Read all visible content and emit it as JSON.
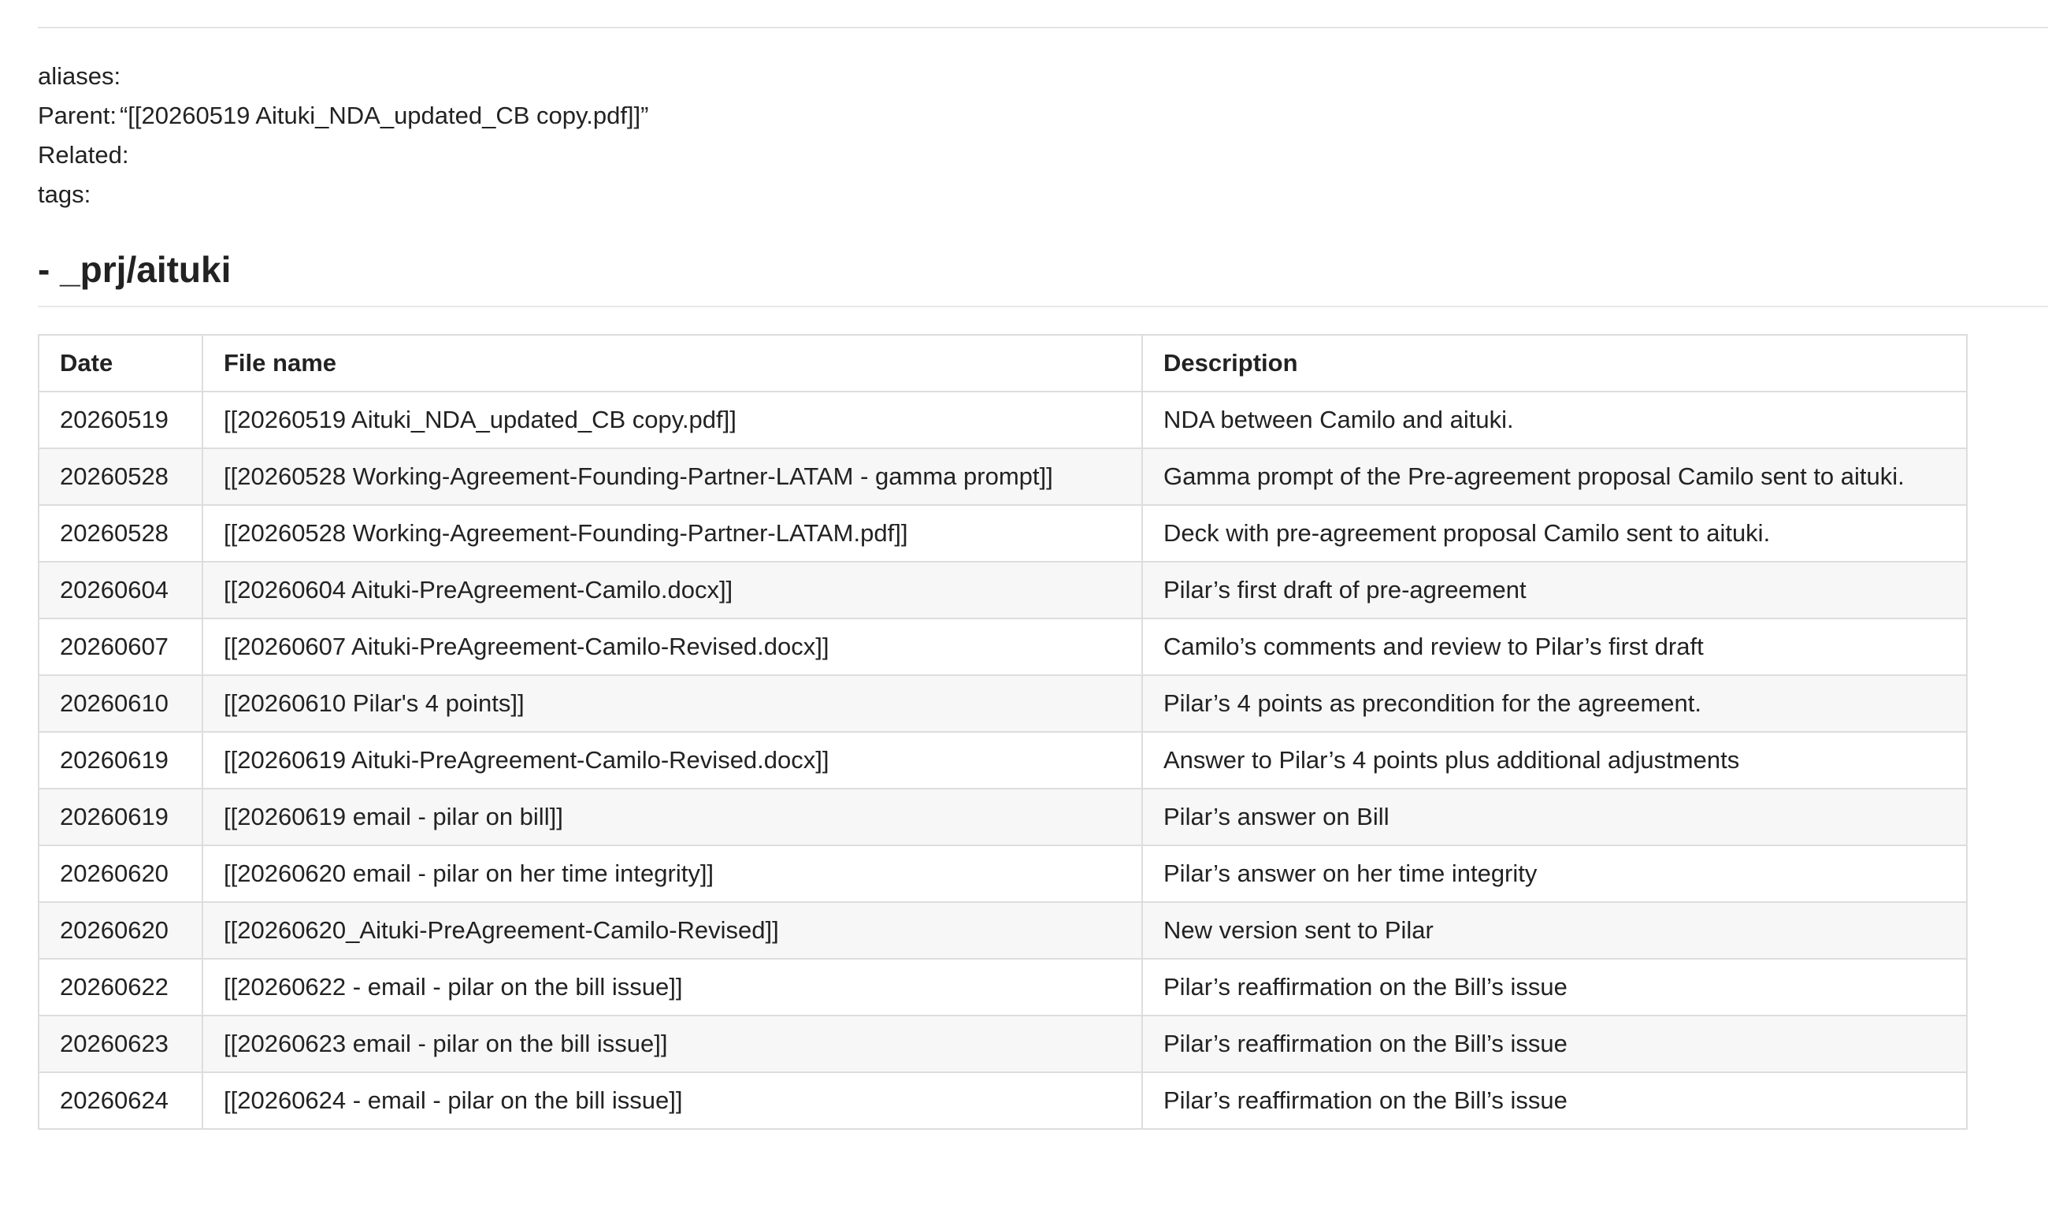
{
  "frontmatter": {
    "aliases": {
      "key": "aliases:",
      "value": ""
    },
    "parent": {
      "key": "Parent:",
      "value": "“[[20260519 Aituki_NDA_updated_CB copy.pdf]]”"
    },
    "related": {
      "key": "Related:",
      "value": ""
    },
    "tags": {
      "key": "tags:",
      "value": ""
    }
  },
  "heading": "- _prj/aituki",
  "table": {
    "headers": [
      "Date",
      "File name",
      "Description"
    ],
    "rows": [
      [
        "20260519",
        "[[20260519 Aituki_NDA_updated_CB copy.pdf]]",
        "NDA between Camilo and aituki."
      ],
      [
        "20260528",
        "[[20260528 Working-Agreement-Founding-Partner-LATAM - gamma prompt]]",
        "Gamma prompt of the Pre-agreement proposal Camilo sent to aituki."
      ],
      [
        "20260528",
        "[[20260528 Working-Agreement-Founding-Partner-LATAM.pdf]]",
        "Deck with pre-agreement proposal Camilo sent to aituki."
      ],
      [
        "20260604",
        "[[20260604 Aituki-PreAgreement-Camilo.docx]]",
        "Pilar’s first draft of pre-agreement"
      ],
      [
        "20260607",
        "[[20260607 Aituki-PreAgreement-Camilo-Revised.docx]]",
        "Camilo’s comments and review to Pilar’s first draft"
      ],
      [
        "20260610",
        "[[20260610 Pilar's 4 points]]",
        "Pilar’s 4 points as precondition for the agreement."
      ],
      [
        "20260619",
        "[[20260619 Aituki-PreAgreement-Camilo-Revised.docx]]",
        "Answer to Pilar’s 4 points plus additional adjustments"
      ],
      [
        "20260619",
        "[[20260619 email - pilar on bill]]",
        "Pilar’s answer on Bill"
      ],
      [
        "20260620",
        "[[20260620 email - pilar on her time integrity]]",
        "Pilar’s answer on her time integrity"
      ],
      [
        "20260620",
        "[[20260620_Aituki-PreAgreement-Camilo-Revised]]",
        "New version sent to Pilar"
      ],
      [
        "20260622",
        "[[20260622 - email - pilar on the bill issue]]",
        "Pilar’s reaffirmation on the Bill’s issue"
      ],
      [
        "20260623",
        "[[20260623 email - pilar on the bill issue]]",
        "Pilar’s reaffirmation on the Bill’s issue"
      ],
      [
        "20260624",
        "[[20260624 - email - pilar on the bill issue]]",
        "Pilar’s reaffirmation on the Bill’s issue"
      ]
    ]
  }
}
